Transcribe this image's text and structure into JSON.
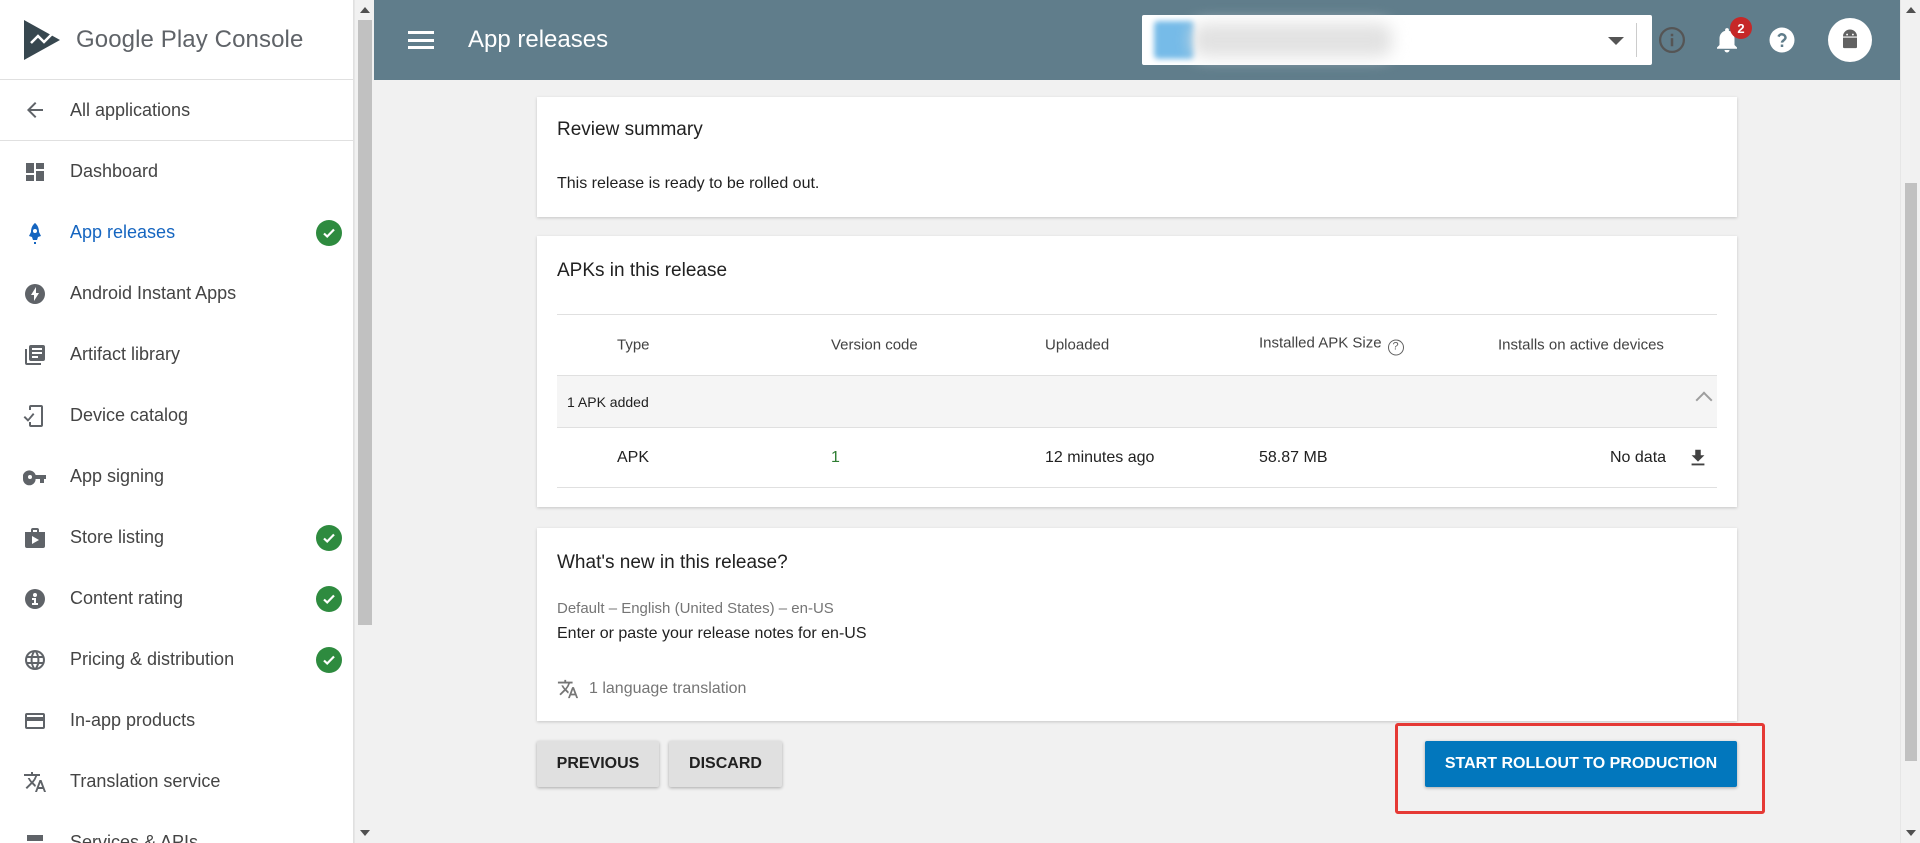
{
  "brand": {
    "name_a": "Google Play",
    "name_b": "Console",
    "accent": "#607d8b"
  },
  "sidebar": {
    "back": "All applications",
    "items": [
      {
        "label": "Dashboard",
        "icon": "dashboard-icon",
        "check": false
      },
      {
        "label": "App releases",
        "icon": "rocket-icon",
        "check": true,
        "active": true
      },
      {
        "label": "Android Instant Apps",
        "icon": "flash-icon",
        "check": false
      },
      {
        "label": "Artifact library",
        "icon": "library-icon",
        "check": false
      },
      {
        "label": "Device catalog",
        "icon": "device-icon",
        "check": false
      },
      {
        "label": "App signing",
        "icon": "key-icon",
        "check": false
      },
      {
        "label": "Store listing",
        "icon": "store-icon",
        "check": true
      },
      {
        "label": "Content rating",
        "icon": "rating-icon",
        "check": true
      },
      {
        "label": "Pricing & distribution",
        "icon": "globe-icon",
        "check": true
      },
      {
        "label": "In-app products",
        "icon": "card-icon",
        "check": false
      },
      {
        "label": "Translation service",
        "icon": "translate-icon",
        "check": false
      },
      {
        "label": "Services & APIs",
        "icon": "services-icon",
        "check": false
      }
    ]
  },
  "header": {
    "title": "App releases",
    "notifications": "2"
  },
  "review": {
    "title": "Review summary",
    "message": "This release is ready to be rolled out."
  },
  "apks": {
    "title": "APKs in this release",
    "columns": [
      "Type",
      "Version code",
      "Uploaded",
      "Installed APK Size",
      "Installs on active devices"
    ],
    "group": "1 APK added",
    "row": {
      "type": "APK",
      "version": "1",
      "uploaded": "12 minutes ago",
      "size": "58.87 MB",
      "installs": "No data"
    }
  },
  "whats_new": {
    "title": "What's new in this release?",
    "language": "Default – English (United States) – en-US",
    "placeholder": "Enter or paste your release notes for en-US",
    "translations": "1 language translation"
  },
  "buttons": {
    "previous": "PREVIOUS",
    "discard": "DISCARD",
    "rollout": "START ROLLOUT TO PRODUCTION"
  },
  "colors": {
    "primary_button": "#0277bd",
    "check": "#2e8b3f",
    "highlight": "#e53935"
  }
}
